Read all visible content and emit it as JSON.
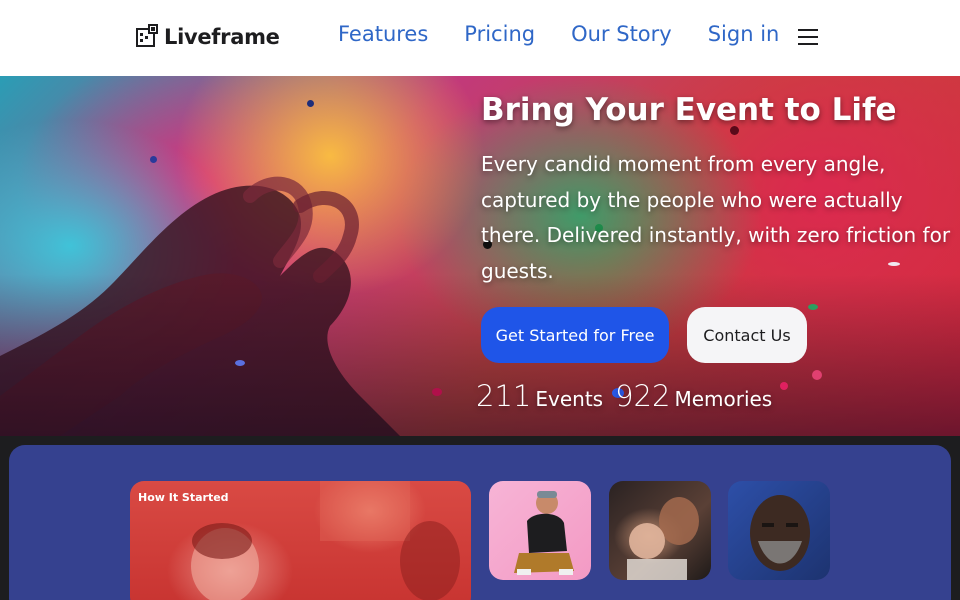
{
  "header": {
    "brand": "Liveframe",
    "nav": [
      "Features",
      "Pricing",
      "Our Story",
      "Sign in"
    ]
  },
  "hero": {
    "title": "Bring Your Event to Life",
    "subtitle": "Every candid moment from every angle, captured by the people who were actually there. Delivered instantly, with zero friction for guests.",
    "primary_cta": "Get Started for Free",
    "secondary_cta": "Contact Us",
    "stats": [
      {
        "value": "211",
        "label": "Events"
      },
      {
        "value": "922",
        "label": "Memories"
      }
    ]
  },
  "story": {
    "label": "How It Started"
  },
  "colors": {
    "brand_blue": "#2f67c7",
    "cta_blue": "#1f55e8",
    "panel": "#35418f"
  }
}
